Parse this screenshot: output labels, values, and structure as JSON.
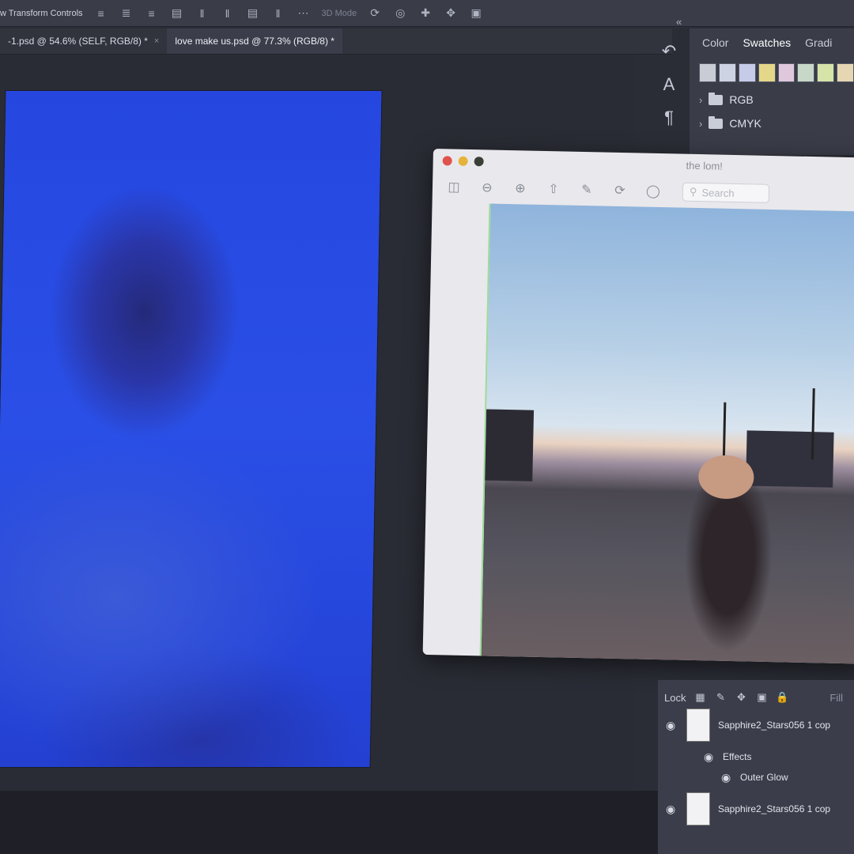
{
  "options_bar": {
    "label": "w Transform Controls",
    "mode": "3D Mode"
  },
  "tabs": [
    {
      "label": "-1.psd @ 54.6% (SELF, RGB/8) *",
      "active": false
    },
    {
      "label": "love make us.psd @ 77.3% (RGB/8) *",
      "active": true
    }
  ],
  "swatch_panel": {
    "tabs": [
      "Color",
      "Swatches",
      "Gradi"
    ],
    "selected_tab": "Swatches",
    "swatch_colors": [
      "#c9ccd4",
      "#cdd3e3",
      "#c5cbe8",
      "#e4d78a",
      "#e0c8dc",
      "#c8d8c8",
      "#d6e4a8",
      "#e6d6b2"
    ],
    "folders": [
      "RGB",
      "CMYK"
    ]
  },
  "preview_window": {
    "title": "the lom!",
    "search_placeholder": "Search"
  },
  "layers_panel": {
    "lock_label": "Lock",
    "fill_label": "Fill",
    "layers": [
      {
        "name": "Sapphire2_Stars056 1 cop",
        "visible": true
      },
      {
        "name": "Sapphire2_Stars056 1 cop",
        "visible": true
      }
    ],
    "effects_label": "Effects",
    "effect_item": "Outer Glow"
  },
  "colors": {
    "canvas_blue": "#2a4fe6",
    "ui_dark": "#3a3d48"
  }
}
